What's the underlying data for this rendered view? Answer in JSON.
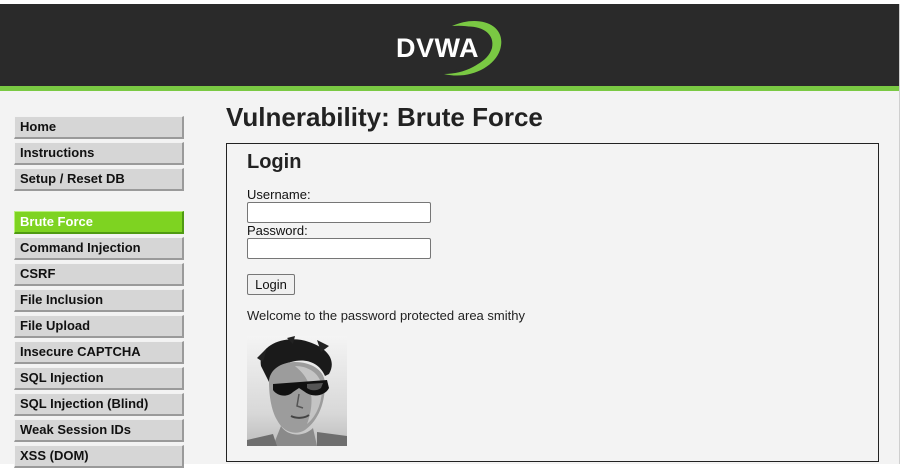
{
  "header": {
    "logo_text": "DVWA",
    "accent_color": "#7ac943"
  },
  "menu": {
    "group_main": [
      {
        "label": "Home"
      },
      {
        "label": "Instructions"
      },
      {
        "label": "Setup / Reset DB"
      }
    ],
    "group_vulns": [
      {
        "label": "Brute Force",
        "active": true
      },
      {
        "label": "Command Injection"
      },
      {
        "label": "CSRF"
      },
      {
        "label": "File Inclusion"
      },
      {
        "label": "File Upload"
      },
      {
        "label": "Insecure CAPTCHA"
      },
      {
        "label": "SQL Injection"
      },
      {
        "label": "SQL Injection (Blind)"
      },
      {
        "label": "Weak Session IDs"
      },
      {
        "label": "XSS (DOM)"
      }
    ],
    "active_color": "#7ed321"
  },
  "main": {
    "title": "Vulnerability: Brute Force",
    "form": {
      "heading": "Login",
      "username_label": "Username:",
      "username_value": "",
      "password_label": "Password:",
      "password_value": "",
      "submit_label": "Login"
    },
    "welcome_message": "Welcome to the password protected area smithy",
    "user_image": "user-avatar-photo"
  }
}
